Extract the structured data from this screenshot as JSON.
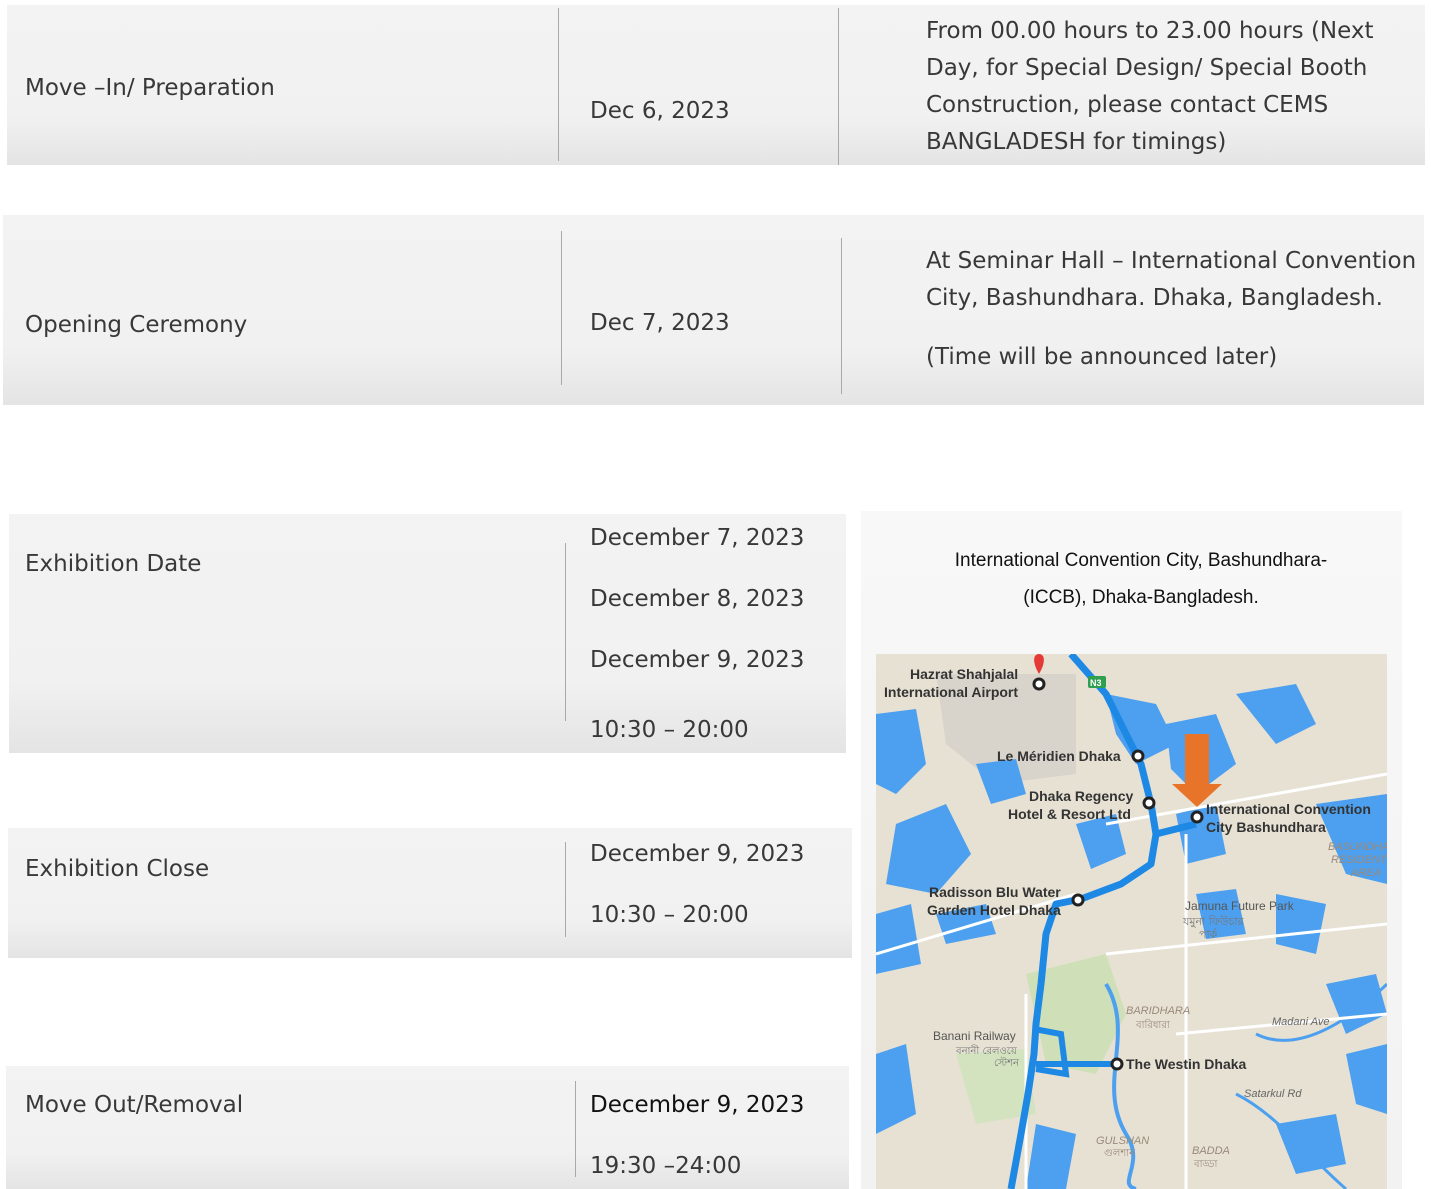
{
  "rows": {
    "move_in": {
      "label": "Move –In/ Preparation",
      "date": "Dec 6, 2023",
      "note_lines": [
        "From   00.00 hours to 23.00 hours (Next",
        "Day, for Special Design/ Special Booth",
        "Construction, please contact CEMS",
        "BANGLADESH for timings)"
      ]
    },
    "opening": {
      "label": "Opening Ceremony",
      "date": "Dec 7, 2023",
      "note_lines": [
        "At Seminar Hall – International Convention",
        "City, Bashundhara. Dhaka, Bangladesh."
      ],
      "note_extra": "(Time will be announced later)"
    },
    "exhibition_date": {
      "label": "Exhibition Date",
      "dates": [
        "December 7, 2023",
        "December 8, 2023",
        "December 9, 2023"
      ],
      "time": "10:30 – 20:00"
    },
    "exhibition_close": {
      "label": "Exhibition Close",
      "date": "December 9, 2023",
      "time": "10:30 – 20:00"
    },
    "move_out": {
      "label": "Move Out/Removal",
      "date": "December 9, 2023",
      "time": "19:30 –24:00"
    }
  },
  "venue": {
    "title_lines": [
      "International Convention City, Bashundhara-",
      "(ICCB), Dhaka-Bangladesh."
    ]
  },
  "map": {
    "labels": {
      "airport": [
        "Hazrat Shahjalal",
        "International Airport"
      ],
      "road_badge": "N3",
      "meridien": "Le Méridien Dhaka",
      "regency": [
        "Dhaka Regency",
        "Hotel & Resort Ltd"
      ],
      "iccb": [
        "International Convention",
        "City Bashundhara"
      ],
      "bashundhara_area": [
        "BASUNDHA",
        "RESIDENTI",
        "AREA"
      ],
      "radisson": [
        "Radisson Blu Water",
        "Garden Hotel Dhaka"
      ],
      "jamuna": "Jamuna Future Park",
      "jamuna_bn": "যমুনা ফিউচার",
      "jamuna_bn2": "পার্ক",
      "baridhara": "BARIDHARA",
      "baridhara_bn": "বারিধারা",
      "madani": "Madani Ave",
      "banani": "Banani Railway",
      "banani_bn": "বনানী রেলওয়ে",
      "banani_bn2": "স্টেশন",
      "westin": "The Westin Dhaka",
      "satarkul": "Satarkul Rd",
      "gulshan": "GULSHAN",
      "gulshan_bn": "গুলশান",
      "badda": "BADDA",
      "badda_bn": "বাড্ডা"
    },
    "colors": {
      "route": "#1e88e5",
      "water": "#4da0ef",
      "land": "#e7e1d4",
      "arrow": "#e8742a",
      "pin": "#e53935"
    }
  }
}
